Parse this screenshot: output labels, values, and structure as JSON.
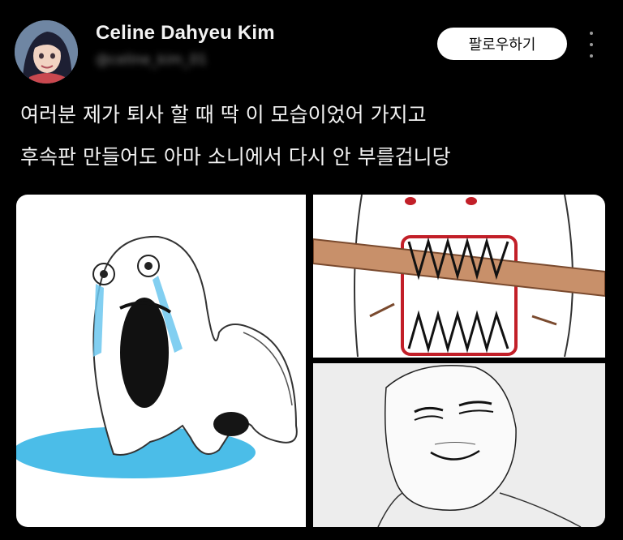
{
  "user": {
    "display_name": "Celine Dahyeu Kim",
    "handle": "@celine_kim_01"
  },
  "actions": {
    "follow_label": "팔로우하기",
    "more_icon": "more-vertical-icon"
  },
  "tweet": {
    "lines": [
      "여러분 제가 퇴사 할 때 딱 이 모습이었어 가지고",
      "후속판 만들어도 아마 소니에서 다시 안 부를겁니당"
    ]
  },
  "colors": {
    "background": "#000000",
    "text": "#f2f2f2",
    "follow_button_bg": "#ffffff"
  }
}
